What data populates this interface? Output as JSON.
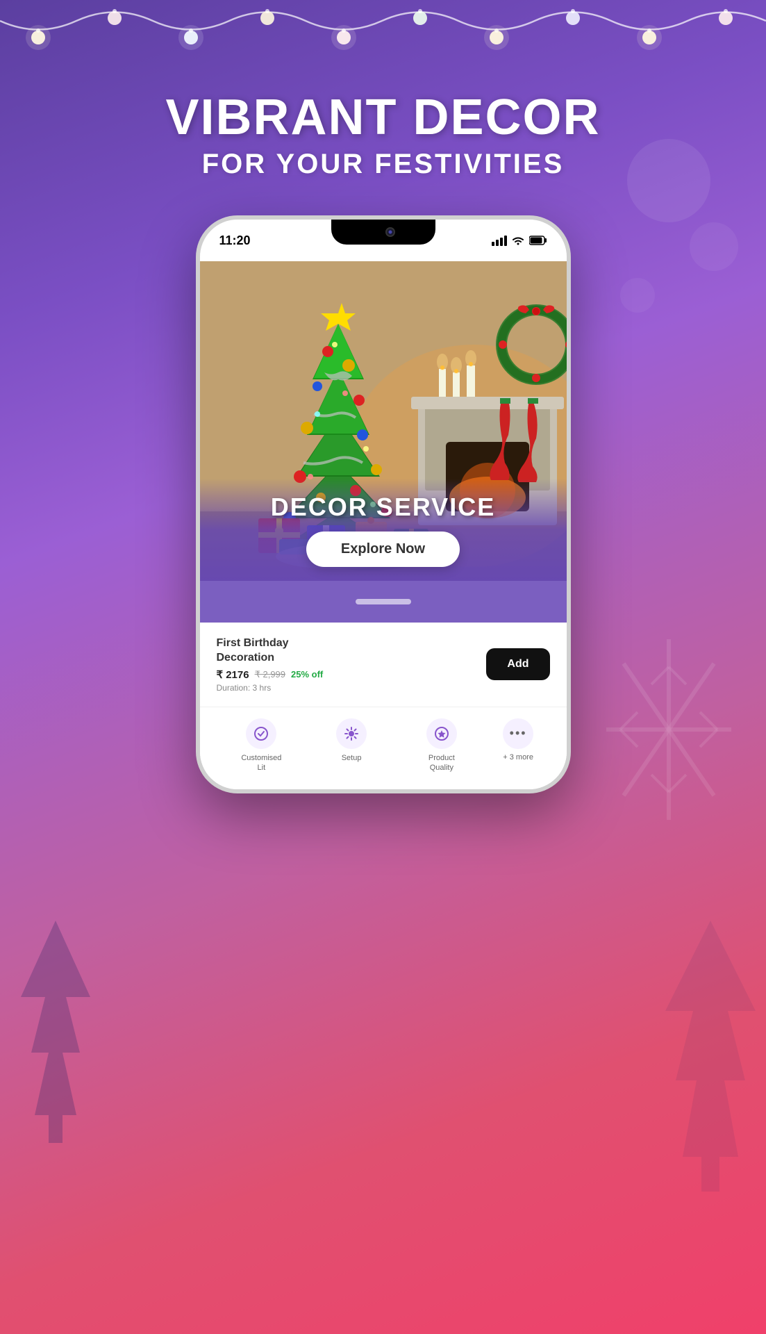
{
  "background": {
    "gradient_start": "#5b3fa0",
    "gradient_end": "#f0406a"
  },
  "header": {
    "main_title": "VIBRANT DECOR",
    "sub_title": "FOR YOUR FESTIVITIES"
  },
  "phone": {
    "time": "11:20",
    "status_signal": "▌▌▌",
    "status_wifi": "WiFi",
    "status_battery": "🔋"
  },
  "service_card": {
    "title": "DECOR SERVICE",
    "explore_btn": "Explore Now",
    "image_alt": "Christmas decorated room with tree and fireplace"
  },
  "product": {
    "name": "First Birthday\nDecoration",
    "price": "₹ 2176",
    "original_price": "₹ 2,999",
    "discount": "25% off",
    "duration": "Duration: 3 hrs",
    "add_label": "Add"
  },
  "ratings": [
    {
      "icon": "⭐",
      "label": "Customised\nLit"
    },
    {
      "icon": "⚙️",
      "label": "Setup"
    },
    {
      "icon": "✅",
      "label": "Product\nQuality"
    }
  ],
  "more_label": "+ 3 more",
  "lights": {
    "bulb_color": "#fff8e0",
    "wire_color": "#ffffff"
  }
}
